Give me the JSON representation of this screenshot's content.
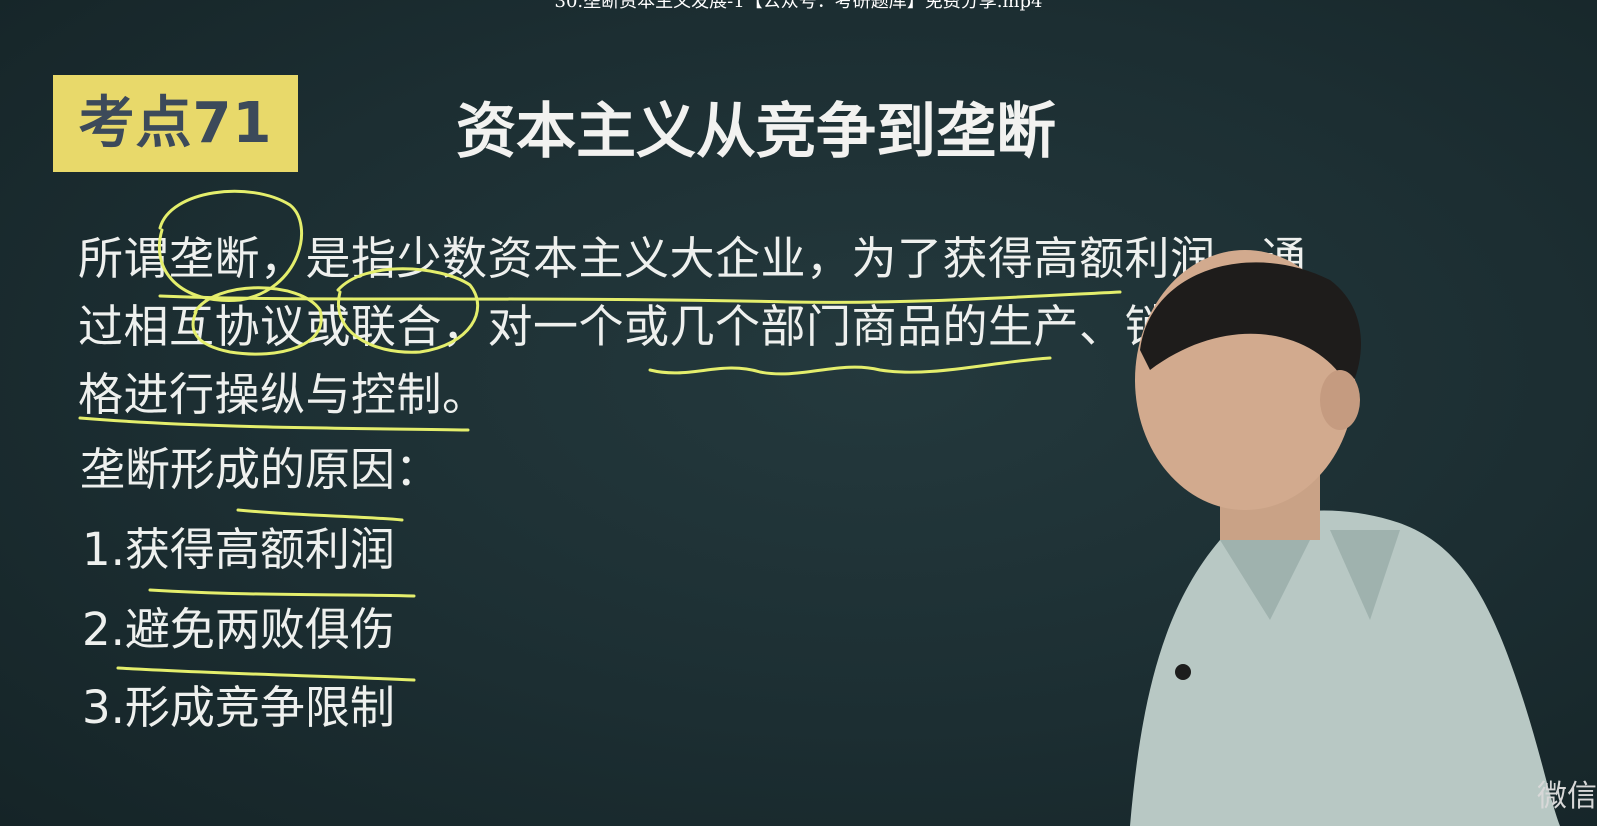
{
  "window": {
    "title": "30.垄断资本主义发展-1【公众号：考研题库】免费分享.mp4"
  },
  "slide": {
    "badge": "考点71",
    "title": "资本主义从竞争到垄断",
    "definition": "所谓垄断，是指少数资本主义大企业，为了获得高额利润，通过相互协议或联合，对一个或几个部门商品的生产、销售和价格进行操纵与控制。",
    "reasons_title": "垄断形成的原因：",
    "reasons": [
      "1.获得高额利润",
      "2.避免两败俱伤",
      "3.形成竞争限制"
    ]
  },
  "watermark": "微信",
  "colors": {
    "board": "#1c2e32",
    "badge": "#e8d96a",
    "ink": "#e4ee6c",
    "text": "#eef0ee"
  }
}
